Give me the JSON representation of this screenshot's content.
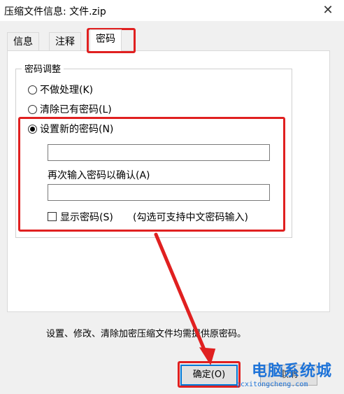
{
  "window": {
    "title": "压缩文件信息: 文件.zip",
    "close_glyph": "✕"
  },
  "tabs": [
    {
      "label": "信息"
    },
    {
      "label": "注释"
    },
    {
      "label": "密码"
    }
  ],
  "group": {
    "legend": "密码调整"
  },
  "options": {
    "no_change": "不做处理(K)",
    "clear": "清除已有密码(L)",
    "set_new": "设置新的密码(N)"
  },
  "fields": {
    "password_value": "",
    "confirm_label": "再次输入密码以确认(A)",
    "confirm_value": ""
  },
  "show_password": {
    "label": "显示密码(S)",
    "note": "(勾选可支持中文密码输入)"
  },
  "hint": "设置、修改、清除加密压缩文件均需提供原密码。",
  "buttons": {
    "ok": "确定(O)",
    "cancel": "取消"
  },
  "watermark": {
    "name": "电脑系统城",
    "url": "pcxitongcheng.com"
  },
  "colors": {
    "annotation_red": "#e02020",
    "accent": "#0078d7"
  }
}
